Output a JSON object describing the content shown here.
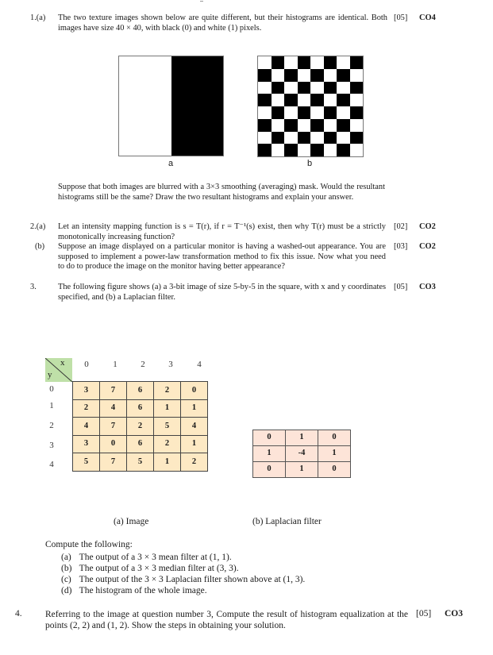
{
  "questions": [
    {
      "number": "1.(a)",
      "text": "The two texture images shown below are quite different, but their histograms are identical. Both images have size 40 × 40, with black (0) and white (1) pixels.",
      "marks": "[05]",
      "co": "CO4",
      "figures": {
        "a_label": "a",
        "b_label": "b"
      },
      "followup": "Suppose that both images are blurred with a 3×3 smoothing (averaging) mask. Would the resultant histograms still be the same? Draw the two resultant histograms and explain your answer."
    },
    {
      "number": "2.(a)",
      "text": "Let an intensity mapping function is s = T(r), if r = T⁻¹(s) exist, then why T(r) must be a strictly monotonically increasing function?",
      "marks": "[02]",
      "co": "CO2"
    },
    {
      "number": "(b)",
      "text": "Suppose an image displayed on a particular monitor is having a washed-out appearance. You are supposed to implement a power-law transformation method to fix this issue. Now what you need to do to produce the image on the monitor having better appearance?",
      "marks": "[03]",
      "co": "CO2"
    },
    {
      "number": "3.",
      "text": "The following figure shows (a) a 3-bit image of size 5-by-5 in the square, with x and y coordinates specified, and (b) a Laplacian filter.",
      "marks": "[05]",
      "co": "CO3",
      "image": {
        "x_axis_label": "x",
        "y_axis_label": "y",
        "x_coords": [
          "0",
          "1",
          "2",
          "3",
          "4"
        ],
        "y_coords": [
          "0",
          "1",
          "2",
          "3",
          "4"
        ],
        "rows": [
          [
            "3",
            "7",
            "6",
            "2",
            "0"
          ],
          [
            "2",
            "4",
            "6",
            "1",
            "1"
          ],
          [
            "4",
            "7",
            "2",
            "5",
            "4"
          ],
          [
            "3",
            "0",
            "6",
            "2",
            "1"
          ],
          [
            "5",
            "7",
            "5",
            "1",
            "2"
          ]
        ],
        "caption": "(a)  Image"
      },
      "laplacian": {
        "rows": [
          [
            "0",
            "1",
            "0"
          ],
          [
            "1",
            "-4",
            "1"
          ],
          [
            "0",
            "1",
            "0"
          ]
        ],
        "caption": "(b) Laplacian  filter"
      },
      "compute_heading": "Compute the following:",
      "sub_items": [
        {
          "label": "(a)",
          "text": "The output of a 3 × 3 mean filter at (1, 1)."
        },
        {
          "label": "(b)",
          "text": "The output of a 3 × 3 median filter at (3, 3)."
        },
        {
          "label": "(c)",
          "text": "The output of the 3 × 3 Laplacian  filter shown above at (1, 3)."
        },
        {
          "label": "(d)",
          "text": "The histogram  of the whole image."
        }
      ]
    },
    {
      "number": "4.",
      "text": "Referring to the image at question number 3, Compute the result of histogram equalization at the points (2, 2) and (1, 2). Show the steps in obtaining your solution.",
      "marks": "[05]",
      "co": "CO3"
    }
  ],
  "colors": {
    "image_cell_bg": "#fde9c4",
    "laplacian_cell_bg": "#fde4d8",
    "corner_bg": "#bfe0a8"
  }
}
